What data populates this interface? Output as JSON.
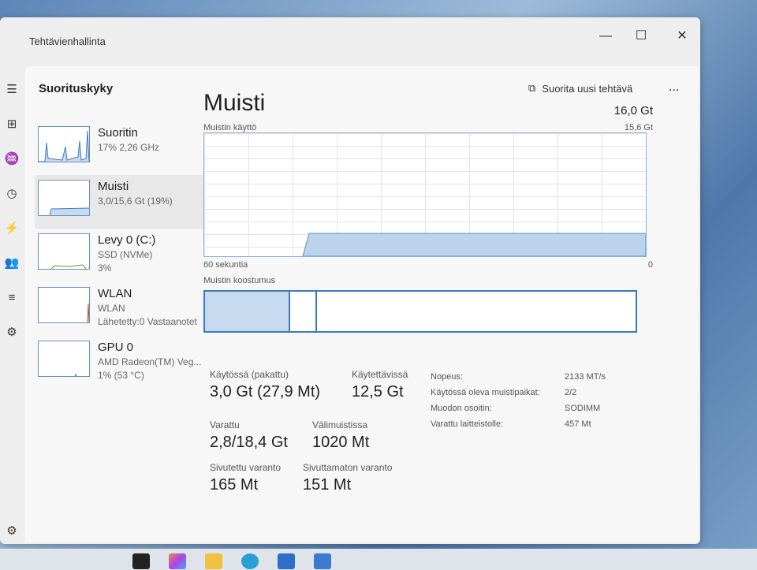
{
  "window": {
    "title": "Tehtävienhallinta",
    "minimize": "—",
    "maximize": "☐",
    "close": "✕"
  },
  "rail": [
    {
      "icon": "hamburger-icon",
      "glyph": "☰"
    },
    {
      "icon": "processes-icon",
      "glyph": "⊞"
    },
    {
      "icon": "performance-icon",
      "glyph": "♒"
    },
    {
      "icon": "history-icon",
      "glyph": "◷"
    },
    {
      "icon": "startup-icon",
      "glyph": "⚡"
    },
    {
      "icon": "users-icon",
      "glyph": "👥"
    },
    {
      "icon": "details-icon",
      "glyph": "≡"
    },
    {
      "icon": "services-icon",
      "glyph": "⚙"
    },
    {
      "icon": "settings-icon",
      "glyph": "⚙"
    }
  ],
  "header": {
    "title": "Suorituskyky",
    "run_task": "Suorita uusi tehtävä",
    "more": "..."
  },
  "sidebar": [
    {
      "name": "Suoritin",
      "sub1": "17% 2,26 GHz",
      "sub2": "",
      "color": "#3d79c2"
    },
    {
      "name": "Muisti",
      "sub1": "3,0/15,6 Gt (19%)",
      "sub2": "",
      "color": "#3d79c2",
      "selected": true
    },
    {
      "name": "Levy 0 (C:)",
      "sub1": "SSD (NVMe)",
      "sub2": "3%",
      "color": "#6b8e23"
    },
    {
      "name": "WLAN",
      "sub1": "WLAN",
      "sub2": "Lähetetty:0 Vastaanotet",
      "color": "#b5543a"
    },
    {
      "name": "GPU 0",
      "sub1": "AMD Radeon(TM) Veg...",
      "sub2": "1% (53 °C)",
      "color": "#3d79c2"
    }
  ],
  "main": {
    "title": "Muisti",
    "total": "16,0 Gt",
    "usage_label": "Muistin käyttö",
    "max_label": "15,6 Gt",
    "time_left": "60 sekuntia",
    "time_right": "0",
    "composition_label": "Muistin koostumus",
    "usage_percent": 19
  },
  "stats": {
    "in_use_label": "Käytössä (pakattu)",
    "in_use": "3,0 Gt (27,9 Mt)",
    "available_label": "Käytettävissä",
    "available": "12,5 Gt",
    "committed_label": "Varattu",
    "committed": "2,8/18,4 Gt",
    "cached_label": "Välimuistissa",
    "cached": "1020 Mt",
    "paged_label": "Sivutettu varanto",
    "paged": "165 Mt",
    "nonpaged_label": "Sivuttamaton varanto",
    "nonpaged": "151 Mt",
    "details": [
      {
        "label": "Nopeus:",
        "value": "2133 MT/s"
      },
      {
        "label": "Käytössä oleva muistipaikat:",
        "value": "2/2"
      },
      {
        "label": "Muodon osoitin:",
        "value": "SODIMM"
      },
      {
        "label": "Varattu laitteistolle:",
        "value": "457 Mt"
      }
    ]
  }
}
